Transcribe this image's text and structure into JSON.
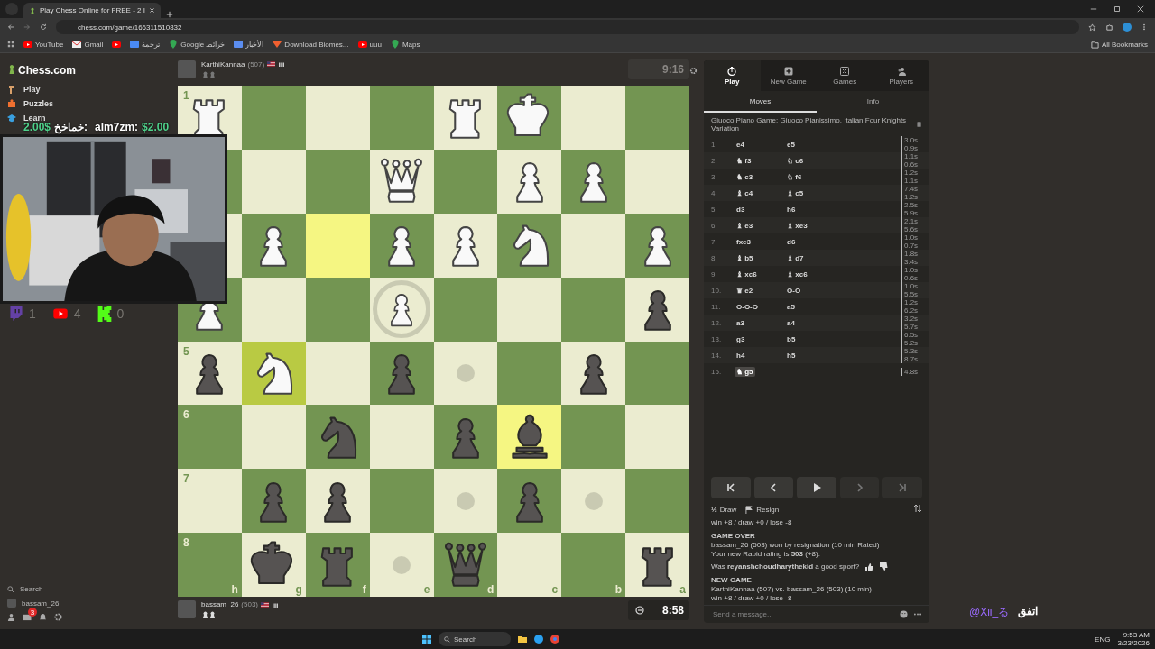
{
  "browser": {
    "tabs": [
      {
        "title": "Play Chess Online for FREE - 2 I",
        "selected": true
      }
    ],
    "url": "chess.com/game/166311510832",
    "bookmarks": [
      {
        "label": "YouTube",
        "kind": "video"
      },
      {
        "label": "Gmail",
        "kind": "mail"
      },
      {
        "kind": "video"
      },
      {
        "label": "ترجمة",
        "kind": "translate"
      },
      {
        "label": "Google خرائط",
        "kind": "pin"
      },
      {
        "label": "الأخبار",
        "kind": "news"
      },
      {
        "label": "Download Biomes...",
        "kind": "web"
      },
      {
        "label": "uuu",
        "kind": "video"
      },
      {
        "label": "Maps",
        "kind": "pin"
      }
    ],
    "all_bookmarks": "All Bookmarks"
  },
  "sidebar": {
    "logo": "Chess.com",
    "items": [
      {
        "label": "Play",
        "kind": "play"
      },
      {
        "label": "Puzzles",
        "kind": "puzzle"
      },
      {
        "label": "Learn",
        "kind": "learn"
      }
    ],
    "search": "Search",
    "user": "bassam_26",
    "mail_badge": "3"
  },
  "overlay": {
    "donations": [
      {
        "name": "خماخخ:",
        "amount": "2.00$",
        "rtl": true
      },
      {
        "name": "alm7zm:",
        "amount": "$2.00",
        "rtl": false
      }
    ],
    "counters": [
      {
        "kind": "twitch",
        "count": "1"
      },
      {
        "kind": "youtube",
        "count": "4"
      },
      {
        "kind": "kick",
        "count": "0"
      }
    ],
    "handle": "@Xii_る",
    "caption": "اتفق"
  },
  "top_player": {
    "name": "KarthiKannaa",
    "rating": "(507)",
    "clock": "9:16",
    "active": false
  },
  "bottom_player": {
    "name": "bassam_26",
    "rating": "(503)",
    "clock": "8:58",
    "active": true
  },
  "board": {
    "rows": [
      {
        "rank": "1",
        "squares": [
          {
            "kind": "rook",
            "white": true,
            "highlighted": false
          },
          {
            "kind": "empty",
            "highlighted": false
          },
          {
            "kind": "empty",
            "highlighted": false
          },
          {
            "kind": "empty",
            "highlighted": false
          },
          {
            "kind": "rook",
            "white": true,
            "highlighted": false
          },
          {
            "kind": "king",
            "white": true,
            "highlighted": false
          },
          {
            "kind": "empty",
            "highlighted": false
          },
          {
            "kind": "empty",
            "highlighted": false
          }
        ]
      },
      {
        "squares": [
          {
            "kind": "empty",
            "highlighted": false
          },
          {
            "kind": "empty",
            "highlighted": false
          },
          {
            "kind": "empty",
            "highlighted": false
          },
          {
            "kind": "queen",
            "white": true,
            "highlighted": false
          },
          {
            "kind": "empty",
            "highlighted": false
          },
          {
            "kind": "pawn",
            "white": true,
            "highlighted": false
          },
          {
            "kind": "pawn",
            "white": true,
            "highlighted": false
          },
          {
            "kind": "empty",
            "highlighted": false
          }
        ]
      },
      {
        "squares": [
          {
            "kind": "empty",
            "highlighted": false
          },
          {
            "kind": "pawn",
            "white": true,
            "highlighted": false
          },
          {
            "kind": "empty",
            "highlighted": true
          },
          {
            "kind": "pawn",
            "white": true,
            "highlighted": false
          },
          {
            "kind": "pawn",
            "white": true,
            "highlighted": false
          },
          {
            "kind": "knight",
            "white": true,
            "highlighted": false
          },
          {
            "kind": "empty",
            "highlighted": false
          },
          {
            "kind": "pawn",
            "white": true,
            "highlighted": false
          }
        ]
      },
      {
        "squares": [
          {
            "kind": "pawn",
            "white": true,
            "highlighted": false
          },
          {
            "kind": "empty",
            "highlighted": false
          },
          {
            "kind": "empty",
            "highlighted": false
          },
          {
            "kind": "pawn",
            "white": true,
            "highlighted": false,
            "ring": true
          },
          {
            "kind": "empty",
            "highlighted": false
          },
          {
            "kind": "empty",
            "highlighted": false
          },
          {
            "kind": "empty",
            "highlighted": false
          },
          {
            "kind": "pawn",
            "white": false,
            "highlighted": false
          }
        ]
      },
      {
        "rank": "5",
        "squares": [
          {
            "kind": "pawn",
            "white": false,
            "highlighted": false
          },
          {
            "kind": "knight",
            "white": true,
            "highlighted": true
          },
          {
            "kind": "empty",
            "highlighted": false
          },
          {
            "kind": "pawn",
            "white": false,
            "highlighted": false
          },
          {
            "kind": "empty",
            "highlighted": false,
            "dot": true
          },
          {
            "kind": "empty",
            "highlighted": false
          },
          {
            "kind": "pawn",
            "white": false,
            "highlighted": false
          },
          {
            "kind": "empty",
            "highlighted": false
          }
        ]
      },
      {
        "rank": "6",
        "squares": [
          {
            "kind": "empty",
            "highlighted": false
          },
          {
            "kind": "empty",
            "highlighted": false
          },
          {
            "kind": "knight",
            "white": false,
            "highlighted": false
          },
          {
            "kind": "empty",
            "highlighted": false
          },
          {
            "kind": "pawn",
            "white": false,
            "highlighted": false
          },
          {
            "kind": "bishop",
            "white": false,
            "highlighted": true
          },
          {
            "kind": "empty",
            "highlighted": false
          },
          {
            "kind": "empty",
            "highlighted": false
          }
        ]
      },
      {
        "rank": "7",
        "squares": [
          {
            "kind": "empty",
            "highlighted": false
          },
          {
            "kind": "pawn",
            "white": false,
            "highlighted": false
          },
          {
            "kind": "pawn",
            "white": false,
            "highlighted": false
          },
          {
            "kind": "empty",
            "highlighted": false
          },
          {
            "kind": "empty",
            "highlighted": false,
            "dot": true
          },
          {
            "kind": "pawn",
            "white": false,
            "highlighted": false
          },
          {
            "kind": "empty",
            "highlighted": false,
            "dot": true
          },
          {
            "kind": "empty",
            "highlighted": false
          }
        ]
      },
      {
        "rank": "8",
        "squares": [
          {
            "kind": "empty",
            "highlighted": false
          },
          {
            "kind": "king",
            "white": false,
            "highlighted": false
          },
          {
            "kind": "rook",
            "white": false,
            "highlighted": false
          },
          {
            "kind": "empty",
            "highlighted": false,
            "dot": true
          },
          {
            "kind": "queen",
            "white": false,
            "highlighted": false
          },
          {
            "kind": "empty",
            "highlighted": false
          },
          {
            "kind": "empty",
            "highlighted": false
          },
          {
            "kind": "rook",
            "white": false,
            "highlighted": false
          }
        ]
      }
    ],
    "files": [
      "h",
      "g",
      "f",
      "e",
      "d",
      "c",
      "b",
      "a"
    ]
  },
  "panel": {
    "tabs": [
      {
        "label": "Play",
        "kind": "clock",
        "selected": true
      },
      {
        "label": "New Game",
        "kind": "plus",
        "selected": false
      },
      {
        "label": "Games",
        "kind": "grid",
        "selected": false
      },
      {
        "label": "Players",
        "kind": "people",
        "selected": false
      }
    ],
    "subtabs": [
      {
        "label": "Moves",
        "selected": true
      },
      {
        "label": "Info",
        "selected": false
      }
    ],
    "opening": "Giuoco Piano Game: Giuoco Pianissimo, Italian Four Knights Variation",
    "moves": [
      {
        "num": "1.",
        "white": {
          "san": "e4",
          "selected": false
        },
        "black": {
          "san": "e5",
          "selected": false
        },
        "times": [
          "3.0s",
          "0.9s"
        ]
      },
      {
        "num": "2.",
        "white": {
          "icon": "♞",
          "san": "f3",
          "selected": false
        },
        "black": {
          "icon": "♘",
          "san": "c6",
          "selected": false
        },
        "times": [
          "1.1s",
          "0.6s"
        ]
      },
      {
        "num": "3.",
        "white": {
          "icon": "♞",
          "san": "c3",
          "selected": false
        },
        "black": {
          "icon": "♘",
          "san": "f6",
          "selected": false
        },
        "times": [
          "1.2s",
          "1.1s"
        ]
      },
      {
        "num": "4.",
        "white": {
          "icon": "♝",
          "san": "c4",
          "selected": false
        },
        "black": {
          "icon": "♗",
          "san": "c5",
          "selected": false
        },
        "times": [
          "7.4s",
          "1.2s"
        ]
      },
      {
        "num": "5.",
        "white": {
          "san": "d3",
          "selected": false
        },
        "black": {
          "san": "h6",
          "selected": false
        },
        "times": [
          "2.5s",
          "5.9s"
        ]
      },
      {
        "num": "6.",
        "white": {
          "icon": "♝",
          "san": "e3",
          "selected": false
        },
        "black": {
          "icon": "♗",
          "san": "xe3",
          "selected": false
        },
        "times": [
          "2.1s",
          "5.6s"
        ]
      },
      {
        "num": "7.",
        "white": {
          "san": "fxe3",
          "selected": false
        },
        "black": {
          "san": "d6",
          "selected": false
        },
        "times": [
          "1.0s",
          "0.7s"
        ]
      },
      {
        "num": "8.",
        "white": {
          "icon": "♝",
          "san": "b5",
          "selected": false
        },
        "black": {
          "icon": "♗",
          "san": "d7",
          "selected": false
        },
        "times": [
          "1.8s",
          "3.4s"
        ]
      },
      {
        "num": "9.",
        "white": {
          "icon": "♝",
          "san": "xc6",
          "selected": false
        },
        "black": {
          "icon": "♗",
          "san": "xc6",
          "selected": false
        },
        "times": [
          "1.0s",
          "0.6s"
        ]
      },
      {
        "num": "10.",
        "white": {
          "icon": "♛",
          "san": "e2",
          "selected": false
        },
        "black": {
          "san": "O-O",
          "selected": false
        },
        "times": [
          "1.0s",
          "5.5s"
        ]
      },
      {
        "num": "11.",
        "white": {
          "san": "O-O-O",
          "selected": false
        },
        "black": {
          "san": "a5",
          "selected": false
        },
        "times": [
          "1.2s",
          "6.2s"
        ]
      },
      {
        "num": "12.",
        "white": {
          "san": "a3",
          "selected": false
        },
        "black": {
          "san": "a4",
          "selected": false
        },
        "times": [
          "3.2s",
          "5.7s"
        ]
      },
      {
        "num": "13.",
        "white": {
          "san": "g3",
          "selected": false
        },
        "black": {
          "san": "b5",
          "selected": false
        },
        "times": [
          "6.5s",
          "5.2s"
        ]
      },
      {
        "num": "14.",
        "white": {
          "san": "h4",
          "selected": false
        },
        "black": {
          "san": "h5",
          "selected": false
        },
        "times": [
          "5.3s",
          "8.7s"
        ]
      },
      {
        "num": "15.",
        "white": {
          "icon": "♞",
          "san": "g5",
          "selected": true
        },
        "times": [
          "4.8s"
        ]
      }
    ],
    "nav": [
      {
        "kind": "first",
        "disabled": false
      },
      {
        "kind": "prev",
        "disabled": false
      },
      {
        "kind": "play",
        "disabled": false
      },
      {
        "kind": "next",
        "disabled": true
      },
      {
        "kind": "last",
        "disabled": true
      }
    ],
    "actions": [
      {
        "icon": "½",
        "label": "Draw",
        "kind": "draw"
      },
      {
        "label": "Resign",
        "kind": "resign"
      }
    ],
    "chat": [
      {
        "kind": "text",
        "text": "win +8 / draw +0 / lose -8"
      },
      {
        "kind": "heading",
        "text": "GAME OVER"
      },
      {
        "kind": "line",
        "text": "bassam_26 (503) won by resignation (10 min Rated)"
      },
      {
        "kind": "text",
        "text": "Your new Rapid rating is **503** (+8)."
      },
      {
        "kind": "sport",
        "text": "Was **reyanshchoudharythekid** a good sport?"
      },
      {
        "kind": "heading",
        "text": "NEW GAME"
      },
      {
        "kind": "line",
        "text": "KarthiKannaa (507) vs. bassam_26 (503) (10 min)"
      },
      {
        "kind": "text",
        "text": "win +8 / draw +0 / lose -8"
      }
    ],
    "message_placeholder": "Send a message..."
  },
  "taskbar": {
    "search": "Search",
    "language": "ENG",
    "time": "9:53 AM",
    "date": "3/23/2026"
  }
}
